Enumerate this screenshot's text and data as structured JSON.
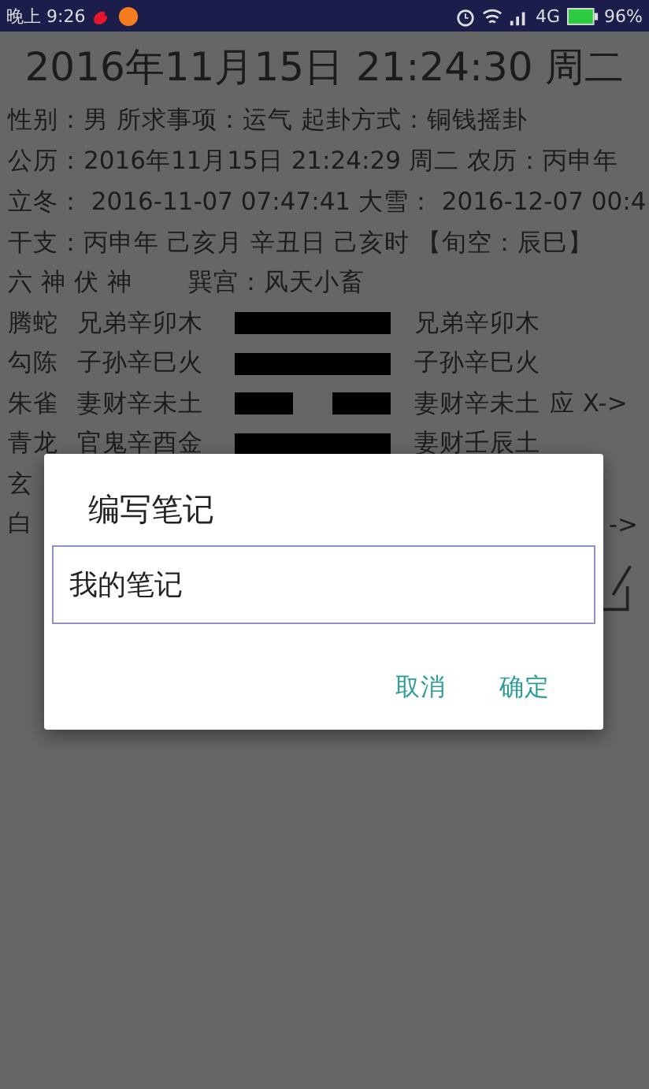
{
  "status_bar": {
    "time": "晚上 9:26",
    "network": "4G",
    "battery": "96%"
  },
  "title": "2016年11月15日 21:24:30 周二",
  "info_lines": [
    "性别：男  所求事项：运气  起卦方式：铜钱摇卦",
    "公历：2016年11月15日 21:24:29 周二  农历：丙申年",
    "立冬： 2016-11-07 07:47:41   大雪： 2016-12-07 00:4",
    "干支：丙申年  己亥月  辛丑日  己亥时  【旬空：辰巳】"
  ],
  "header": {
    "left": "六 神 伏 神",
    "right": "巽宫：风天小畜"
  },
  "lines": [
    {
      "god": "腾蛇",
      "fu": "兄弟辛卯木",
      "kind": "yang",
      "gua": "兄弟辛卯木"
    },
    {
      "god": "勾陈",
      "fu": "子孙辛巳火",
      "kind": "yang",
      "gua": "子孙辛巳火"
    },
    {
      "god": "朱雀",
      "fu": "妻财辛未土",
      "kind": "yin",
      "gua": "妻财辛未土",
      "mark": "应 X->"
    },
    {
      "god": "青龙",
      "fu": "官鬼辛酉金",
      "kind": "yang",
      "gua": "妻财壬辰土"
    },
    {
      "god": "玄"
    },
    {
      "god": "白",
      "mark": "->"
    }
  ],
  "dialog": {
    "title": "编写笔记",
    "value": "我的笔记",
    "buttons": [
      "取消",
      "确定"
    ]
  }
}
